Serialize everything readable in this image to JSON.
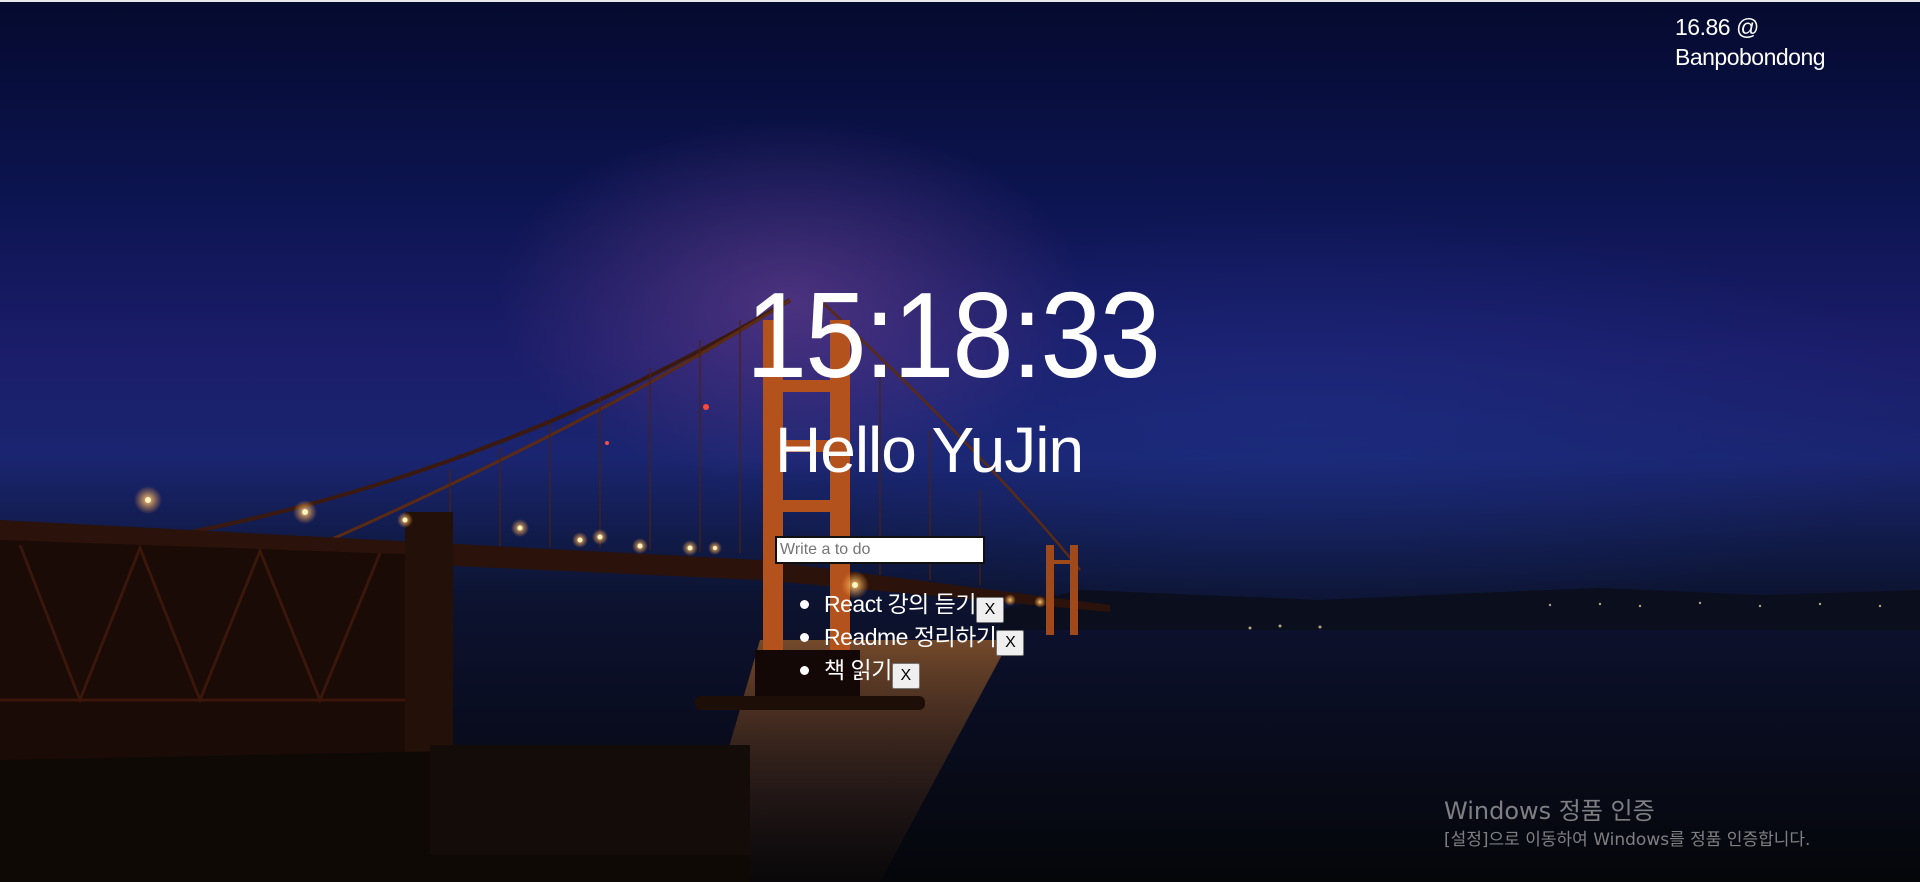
{
  "weather": {
    "temperature": "16.86 @",
    "location": "Banpobondong"
  },
  "clock": {
    "time": "15:18:33"
  },
  "greeting": {
    "text": "Hello YuJin"
  },
  "todo": {
    "placeholder": "Write a to do",
    "items": [
      {
        "label": "React 강의 듣기",
        "delete_label": "X"
      },
      {
        "label": "Readme 정리하기",
        "delete_label": "X"
      },
      {
        "label": "책 읽기",
        "delete_label": "X"
      }
    ]
  },
  "watermark": {
    "title": "Windows 정품 인증",
    "subtitle": "[설정]으로 이동하여 Windows를 정품 인증합니다."
  }
}
